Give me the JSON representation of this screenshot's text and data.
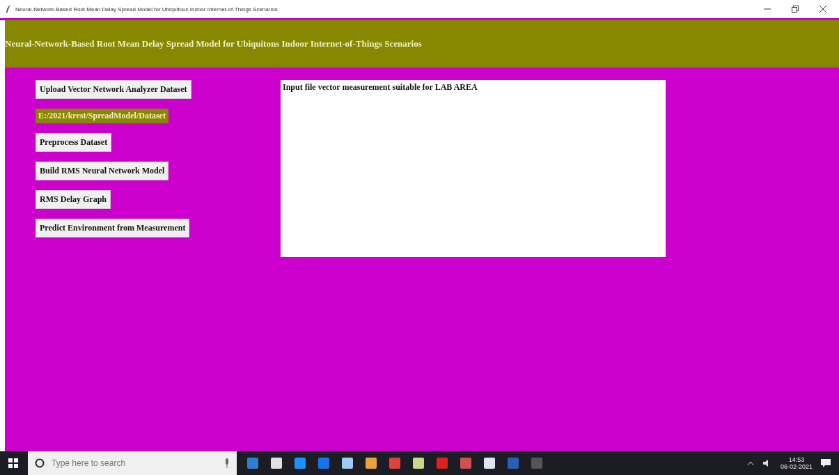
{
  "window": {
    "title": "Neural-Network-Based Root Mean Delay Spread Model for Ubiquitous Indoor Internet-of-Things Scenarios"
  },
  "header": {
    "title": "Neural-Network-Based Root Mean Delay Spread Model for Ubiquitons Indoor Internet-of-Things Scenarios"
  },
  "controls": [
    {
      "kind": "button",
      "label": "Upload Vector Network Analyzer Dataset"
    },
    {
      "kind": "path",
      "label": "E:/2021/krest/SpreadModel/Dataset"
    },
    {
      "kind": "button",
      "label": "Preprocess Dataset"
    },
    {
      "kind": "button",
      "label": "Build RMS Neural Network Model"
    },
    {
      "kind": "button",
      "label": "RMS Delay Graph"
    },
    {
      "kind": "button",
      "label": "Predict Environment from Measurement"
    }
  ],
  "output": {
    "text": "Input file vector measurement suitable for LAB AREA"
  },
  "taskbar": {
    "search": {
      "placeholder": "Type here to search"
    },
    "time": "14:53",
    "date": "06-02-2021"
  }
}
